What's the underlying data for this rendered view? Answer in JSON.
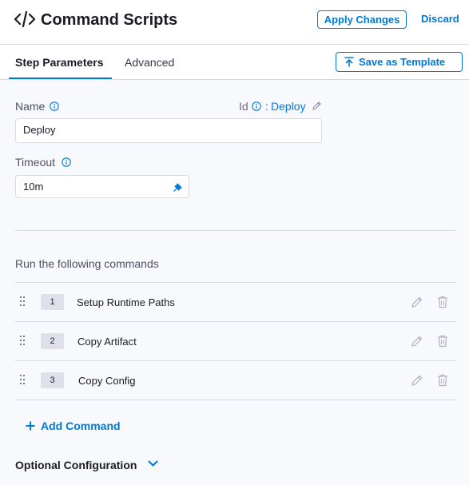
{
  "header": {
    "title": "Command Scripts",
    "apply_label": "Apply Changes",
    "discard_label": "Discard"
  },
  "tabs": [
    {
      "label": "Step Parameters",
      "active": true
    },
    {
      "label": "Advanced",
      "active": false
    }
  ],
  "save_template_label": "Save as Template",
  "form": {
    "name_label": "Name",
    "name_value": "Deploy",
    "id_label": "Id",
    "id_separator": ":",
    "id_value": "Deploy",
    "timeout_label": "Timeout",
    "timeout_value": "10m"
  },
  "commands_section": {
    "title": "Run the following commands",
    "commands": [
      {
        "index": "1",
        "name": "Setup Runtime Paths"
      },
      {
        "index": "2",
        "name": "Copy Artifact"
      },
      {
        "index": "3",
        "name": "Copy Config"
      }
    ],
    "add_label": "Add Command"
  },
  "optional_config_label": "Optional Configuration",
  "colors": {
    "accent": "#0278d5",
    "background": "#f7f9fd",
    "border": "#d9dae6"
  },
  "icons": {
    "title": "code-icon",
    "info": "info-icon",
    "edit": "pencil-icon",
    "delete": "trash-icon",
    "drag": "drag-handle-icon",
    "pin": "pin-icon",
    "upload": "upload-icon",
    "expand": "chevron-down-icon"
  }
}
